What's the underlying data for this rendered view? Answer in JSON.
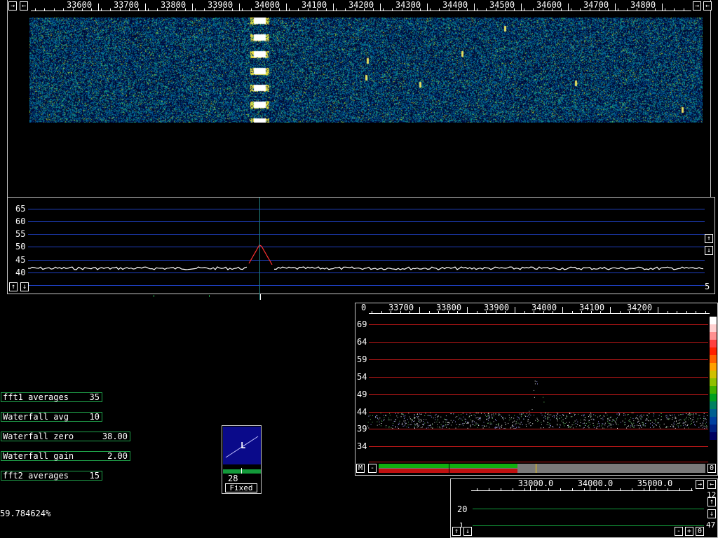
{
  "waterfall": {
    "freq_labels": [
      "33600",
      "33700",
      "33800",
      "33900",
      "34000",
      "34100",
      "34200",
      "34300",
      "34400",
      "34500",
      "34600",
      "34700",
      "34800"
    ],
    "left_buttons": [
      "→",
      "←"
    ],
    "right_buttons": [
      "→",
      "←"
    ]
  },
  "spectrum1": {
    "y_labels": [
      "65",
      "60",
      "55",
      "50",
      "45",
      "40"
    ],
    "up_label": "↑",
    "down_label": "↓",
    "right_value": "5"
  },
  "params": [
    {
      "label": "fft1 averages",
      "value": "35"
    },
    {
      "label": "Waterfall avg",
      "value": "10"
    },
    {
      "label": "Waterfall zero",
      "value": "38.00"
    },
    {
      "label": "Waterfall gain",
      "value": "2.00"
    },
    {
      "label": "fft2 averages",
      "value": "15"
    }
  ],
  "status_percent": "59.784624%",
  "agc_box": {
    "letter": "L",
    "value": "28",
    "mode_label": "Fixed"
  },
  "spectrum2": {
    "corner_label": "0",
    "freq_labels": [
      "33700",
      "33800",
      "33900",
      "34000",
      "34100",
      "34200"
    ],
    "y_labels": [
      "69",
      "64",
      "59",
      "54",
      "49",
      "44",
      "39",
      "34"
    ],
    "m_button": "M",
    "minus_button": "-",
    "right_value": "0"
  },
  "baseband": {
    "freq_labels": [
      "33000.0",
      "34000.0",
      "35000.0"
    ],
    "y_label": "20",
    "right_top": "12",
    "right_bottom": "47",
    "minus_button": "-",
    "plus_button": "+",
    "zero_button": "0",
    "up_label": "↑",
    "down_label": "↓",
    "left_value": "1"
  },
  "colors": {
    "grid_blue": "#1f3fbf",
    "grid_red": "#c01818",
    "grid_green": "#139a3a",
    "param_border": "#1fa24a",
    "bar_green": "#10b010",
    "bar_red": "#c01010",
    "bar_gray": "#7a7a7a"
  }
}
